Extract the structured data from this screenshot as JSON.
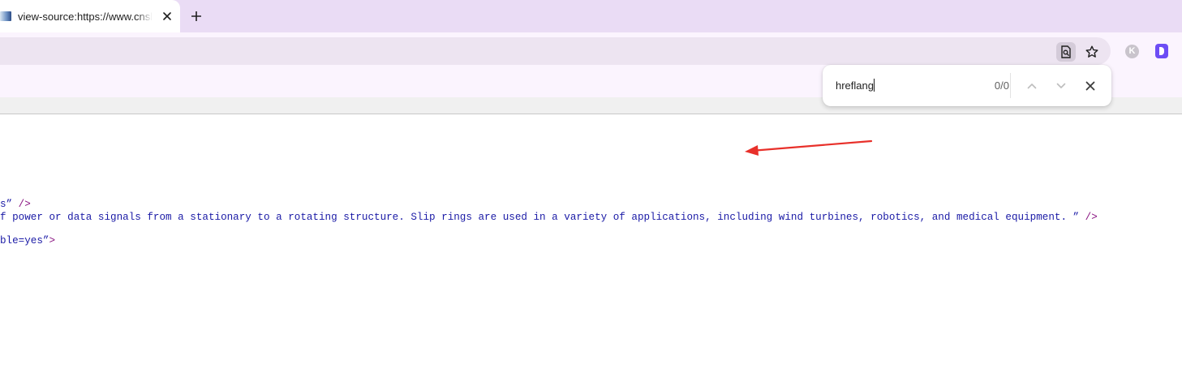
{
  "browser": {
    "tab": {
      "title": "view-source:https://www.cnsl",
      "favicon": "site-favicon"
    },
    "new_tab_icon": "plus-icon",
    "toolbar_icons": [
      "page-search-icon",
      "star-icon"
    ],
    "extensions": [
      {
        "name": "extension-k",
        "letter": "K"
      },
      {
        "name": "extension-d",
        "letter": ""
      }
    ],
    "accent_color": "#eadcf5"
  },
  "find_bar": {
    "query": "hreflang",
    "count": "0/0",
    "prev_icon": "chevron-up-icon",
    "next_icon": "chevron-down-icon",
    "close_icon": "close-icon"
  },
  "source_lines": [
    {
      "value": "s”",
      "tag": " />"
    },
    {
      "value": "f power or data signals from a stationary to a rotating structure. Slip rings are used in a variety of applications, including wind turbines, robotics, and medical equipment. ”",
      "tag": " />"
    },
    {
      "value": "ble=yes”",
      "tag": ">"
    }
  ],
  "annotation": {
    "type": "arrow",
    "color": "#e8302a"
  }
}
